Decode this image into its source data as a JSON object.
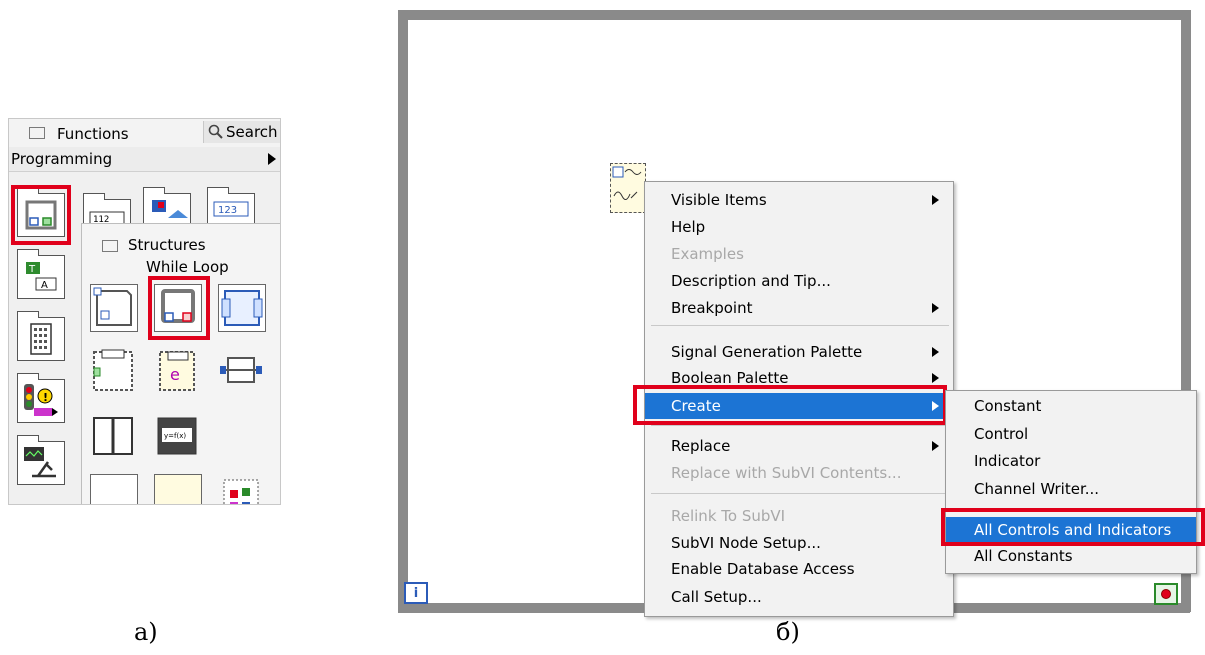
{
  "palette": {
    "title": "Functions",
    "search_label": "Search",
    "category": "Programming",
    "structures": {
      "title": "Structures",
      "hovered_label": "While Loop"
    }
  },
  "context_menu": {
    "items": [
      {
        "label": "Visible Items",
        "submenu": true,
        "enabled": true
      },
      {
        "label": "Help",
        "submenu": false,
        "enabled": true
      },
      {
        "label": "Examples",
        "submenu": false,
        "enabled": false
      },
      {
        "label": "Description and Tip...",
        "submenu": false,
        "enabled": true
      },
      {
        "label": "Breakpoint",
        "submenu": true,
        "enabled": true
      },
      {
        "label": "Signal Generation Palette",
        "submenu": true,
        "enabled": true
      },
      {
        "label": "Boolean Palette",
        "submenu": true,
        "enabled": true
      },
      {
        "label": "Create",
        "submenu": true,
        "enabled": true,
        "highlighted": true
      },
      {
        "label": "Replace",
        "submenu": true,
        "enabled": true
      },
      {
        "label": "Replace with SubVI Contents...",
        "submenu": false,
        "enabled": false
      },
      {
        "label": "Relink To SubVI",
        "submenu": false,
        "enabled": false
      },
      {
        "label": "SubVI Node Setup...",
        "submenu": false,
        "enabled": true
      },
      {
        "label": "Enable Database Access",
        "submenu": false,
        "enabled": true
      },
      {
        "label": "Call Setup...",
        "submenu": false,
        "enabled": true
      }
    ]
  },
  "create_submenu": {
    "items": [
      {
        "label": "Constant"
      },
      {
        "label": "Control"
      },
      {
        "label": "Indicator"
      },
      {
        "label": "Channel Writer..."
      },
      {
        "label": "All Controls and Indicators",
        "highlighted": true
      },
      {
        "label": "All Constants"
      }
    ]
  },
  "diagram": {
    "iteration_terminal": "i"
  },
  "captions": {
    "a": "a)",
    "b": "б)"
  },
  "colors": {
    "highlight": "#1c74d4",
    "callout": "#e0001b"
  }
}
